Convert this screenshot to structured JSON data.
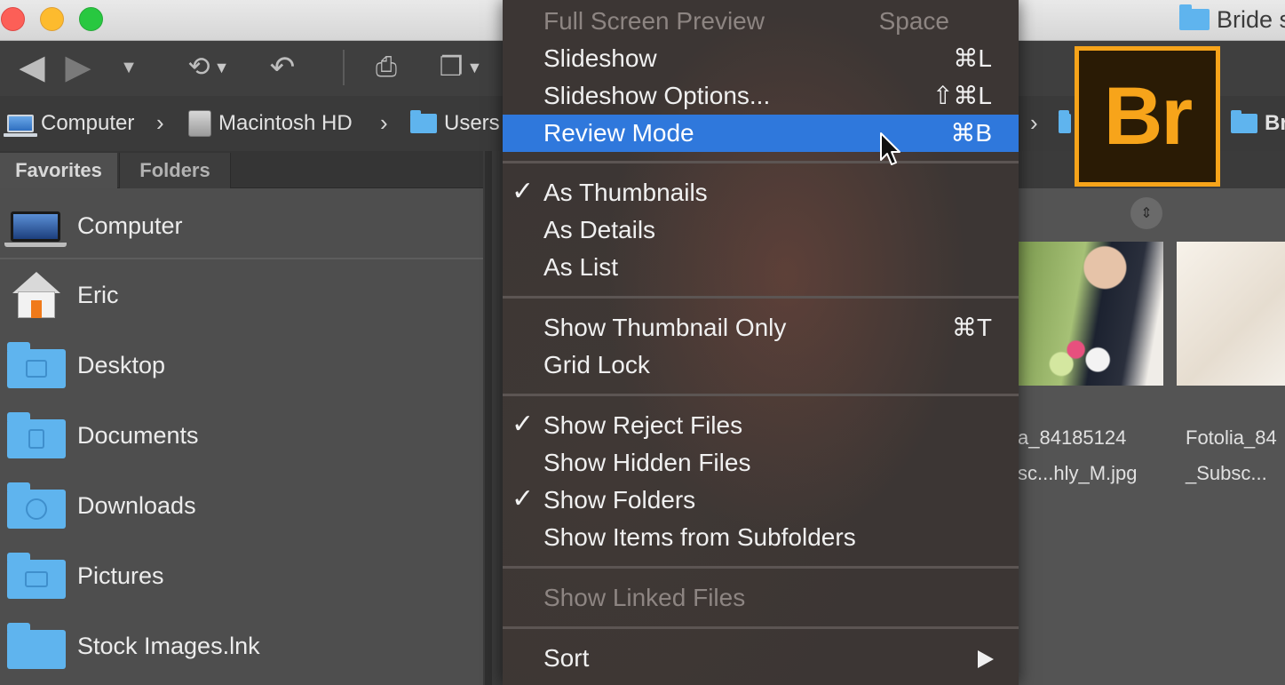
{
  "window": {
    "title": "Bride s"
  },
  "traffic_lights": {
    "close": "#fc5f57",
    "minimize": "#fdbb2e",
    "zoom": "#28c840"
  },
  "toolbar": {
    "icons": [
      "back-arrow-icon",
      "forward-arrow-icon",
      "recent-dropdown-icon",
      "reveal-recent-icon",
      "rotate-icon",
      "camera-import-icon",
      "output-icon"
    ]
  },
  "pathbar": {
    "crumbs": [
      "Computer",
      "Macintosh HD",
      "Users"
    ],
    "right_crumb": "Br"
  },
  "tabs": {
    "favorites": "Favorites",
    "folders": "Folders"
  },
  "favorites": [
    {
      "label": "Computer",
      "icon": "laptop-icon"
    },
    {
      "label": "Eric",
      "icon": "home-icon"
    },
    {
      "label": "Desktop",
      "icon": "desktop-folder-icon"
    },
    {
      "label": "Documents",
      "icon": "documents-folder-icon"
    },
    {
      "label": "Downloads",
      "icon": "downloads-folder-icon"
    },
    {
      "label": "Pictures",
      "icon": "pictures-folder-icon"
    },
    {
      "label": "Stock Images.lnk",
      "icon": "folder-icon"
    }
  ],
  "menu": {
    "full_screen_preview": {
      "label": "Full Screen Preview",
      "shortcut": "Space"
    },
    "slideshow": {
      "label": "Slideshow",
      "shortcut": "⌘L"
    },
    "slideshow_options": {
      "label": "Slideshow Options...",
      "shortcut": "⇧⌘L"
    },
    "review_mode": {
      "label": "Review Mode",
      "shortcut": "⌘B"
    },
    "as_thumbnails": {
      "label": "As Thumbnails",
      "check": "✓"
    },
    "as_details": {
      "label": "As Details"
    },
    "as_list": {
      "label": "As List"
    },
    "show_thumbnail_only": {
      "label": "Show Thumbnail Only",
      "shortcut": "⌘T"
    },
    "grid_lock": {
      "label": "Grid Lock"
    },
    "show_reject_files": {
      "label": "Show Reject Files",
      "check": "✓"
    },
    "show_hidden_files": {
      "label": "Show Hidden Files"
    },
    "show_folders": {
      "label": "Show Folders",
      "check": "✓"
    },
    "show_items_from_subfolders": {
      "label": "Show Items from Subfolders"
    },
    "show_linked_files": {
      "label": "Show Linked Files"
    },
    "sort": {
      "label": "Sort"
    }
  },
  "content": {
    "thumbnails": [
      {
        "line1": "a_84185124",
        "line2": "sc...hly_M.jpg"
      },
      {
        "line1": "Fotolia_84",
        "line2": "_Subsc..."
      }
    ]
  },
  "logo": {
    "text": "Br",
    "accent": "#f7a41a",
    "background": "#2a1b05"
  },
  "colors": {
    "menu_highlight": "#2f78dc"
  }
}
